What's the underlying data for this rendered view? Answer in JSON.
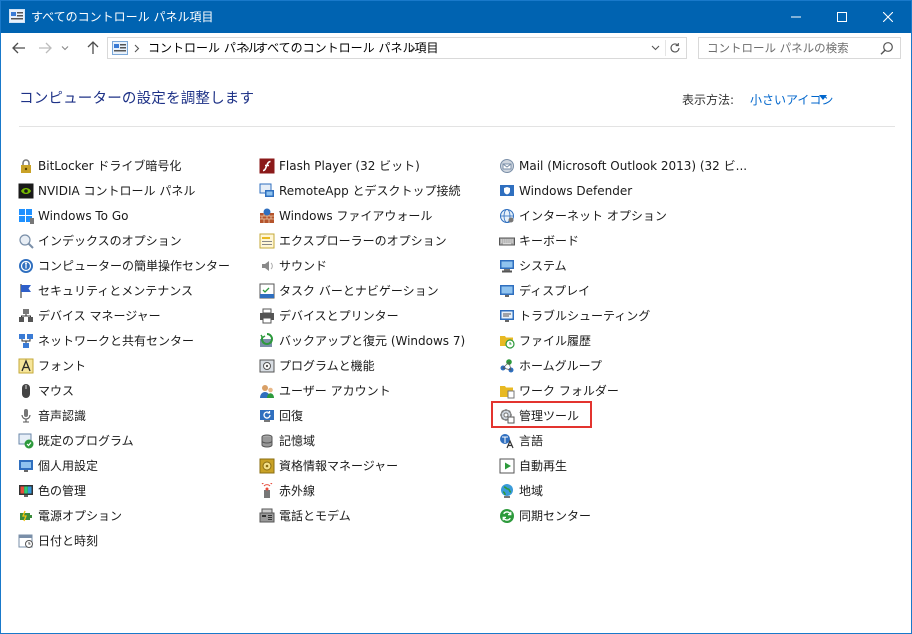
{
  "window": {
    "title": "すべてのコントロール パネル項目",
    "title_color": "#0063b1"
  },
  "address": {
    "crumbs": [
      "コントロール パネル",
      "すべてのコントロール パネル項目"
    ]
  },
  "search": {
    "placeholder": "コントロール パネルの検索"
  },
  "header": {
    "title": "コンピューターの設定を調整します",
    "view_label": "表示方法:",
    "view_value": "小さいアイコン"
  },
  "columns": [
    [
      {
        "label": "BitLocker ドライブ暗号化",
        "icon": "bitlocker-icon"
      },
      {
        "label": "NVIDIA コントロール パネル",
        "icon": "nvidia-icon"
      },
      {
        "label": "Windows To Go",
        "icon": "windows-to-go-icon"
      },
      {
        "label": "インデックスのオプション",
        "icon": "indexing-icon"
      },
      {
        "label": "コンピューターの簡単操作センター",
        "icon": "ease-of-access-icon"
      },
      {
        "label": "セキュリティとメンテナンス",
        "icon": "flag-icon"
      },
      {
        "label": "デバイス マネージャー",
        "icon": "device-manager-icon"
      },
      {
        "label": "ネットワークと共有センター",
        "icon": "network-icon"
      },
      {
        "label": "フォント",
        "icon": "font-icon"
      },
      {
        "label": "マウス",
        "icon": "mouse-icon"
      },
      {
        "label": "音声認識",
        "icon": "microphone-icon"
      },
      {
        "label": "既定のプログラム",
        "icon": "default-programs-icon"
      },
      {
        "label": "個人用設定",
        "icon": "personalization-icon"
      },
      {
        "label": "色の管理",
        "icon": "color-management-icon"
      },
      {
        "label": "電源オプション",
        "icon": "power-options-icon"
      },
      {
        "label": "日付と時刻",
        "icon": "calendar-icon"
      }
    ],
    [
      {
        "label": "Flash Player (32 ビット)",
        "icon": "flash-icon"
      },
      {
        "label": "RemoteApp とデスクトップ接続",
        "icon": "remoteapp-icon"
      },
      {
        "label": "Windows ファイアウォール",
        "icon": "firewall-icon"
      },
      {
        "label": "エクスプローラーのオプション",
        "icon": "folder-options-icon"
      },
      {
        "label": "サウンド",
        "icon": "speaker-icon"
      },
      {
        "label": "タスク バーとナビゲーション",
        "icon": "taskbar-icon"
      },
      {
        "label": "デバイスとプリンター",
        "icon": "printer-icon"
      },
      {
        "label": "バックアップと復元 (Windows 7)",
        "icon": "backup-icon"
      },
      {
        "label": "プログラムと機能",
        "icon": "programs-icon"
      },
      {
        "label": "ユーザー アカウント",
        "icon": "user-accounts-icon"
      },
      {
        "label": "回復",
        "icon": "recovery-icon"
      },
      {
        "label": "記憶域",
        "icon": "storage-icon"
      },
      {
        "label": "資格情報マネージャー",
        "icon": "credential-icon"
      },
      {
        "label": "赤外線",
        "icon": "infrared-icon"
      },
      {
        "label": "電話とモデム",
        "icon": "phone-modem-icon"
      }
    ],
    [
      {
        "label": "Mail (Microsoft Outlook 2013) (32 ビ...",
        "icon": "mail-icon"
      },
      {
        "label": "Windows Defender",
        "icon": "defender-icon"
      },
      {
        "label": "インターネット オプション",
        "icon": "internet-options-icon"
      },
      {
        "label": "キーボード",
        "icon": "keyboard-icon"
      },
      {
        "label": "システム",
        "icon": "system-icon"
      },
      {
        "label": "ディスプレイ",
        "icon": "display-icon"
      },
      {
        "label": "トラブルシューティング",
        "icon": "troubleshooting-icon"
      },
      {
        "label": "ファイル履歴",
        "icon": "file-history-icon"
      },
      {
        "label": "ホームグループ",
        "icon": "homegroup-icon"
      },
      {
        "label": "ワーク フォルダー",
        "icon": "work-folders-icon"
      },
      {
        "label": "管理ツール",
        "icon": "admin-tools-icon"
      },
      {
        "label": "言語",
        "icon": "language-icon"
      },
      {
        "label": "自動再生",
        "icon": "autoplay-icon"
      },
      {
        "label": "地域",
        "icon": "region-icon"
      },
      {
        "label": "同期センター",
        "icon": "sync-center-icon"
      }
    ]
  ],
  "highlighted_item": "管理ツール",
  "colors": {
    "title_bar": "#0063b1",
    "heading": "#1e3287",
    "link": "#0066cc",
    "highlight_border": "#e3342f"
  }
}
